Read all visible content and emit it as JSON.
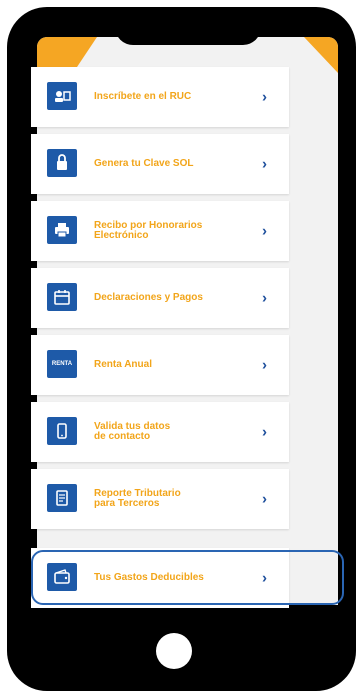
{
  "menu": {
    "items": [
      {
        "label": "Inscríbete en el RUC",
        "icon": "ruc-registration-icon"
      },
      {
        "label": "Genera tu Clave SOL",
        "icon": "lock-key-icon"
      },
      {
        "label": "Recibo por Honorarios\nElectrónico",
        "icon": "printer-receipt-icon"
      },
      {
        "label": "Declaraciones y Pagos",
        "icon": "calendar-payment-icon"
      },
      {
        "label": "Renta Anual",
        "icon": "renta-card-icon",
        "icon_text": "RENTA"
      },
      {
        "label": "Valida tus datos\nde contacto",
        "icon": "mobile-contact-icon"
      },
      {
        "label": "Reporte Tributario\npara Terceros",
        "icon": "document-report-icon"
      },
      {
        "label": "Tus Gastos Deducibles",
        "icon": "wallet-expenses-icon"
      }
    ],
    "chevron": "›"
  },
  "colors": {
    "label": "#f2a51a",
    "icon_bg": "#1e5aa8",
    "chevron": "#1e4f9c",
    "accent": "#f5a623",
    "highlight_border": "#2a65b3"
  }
}
